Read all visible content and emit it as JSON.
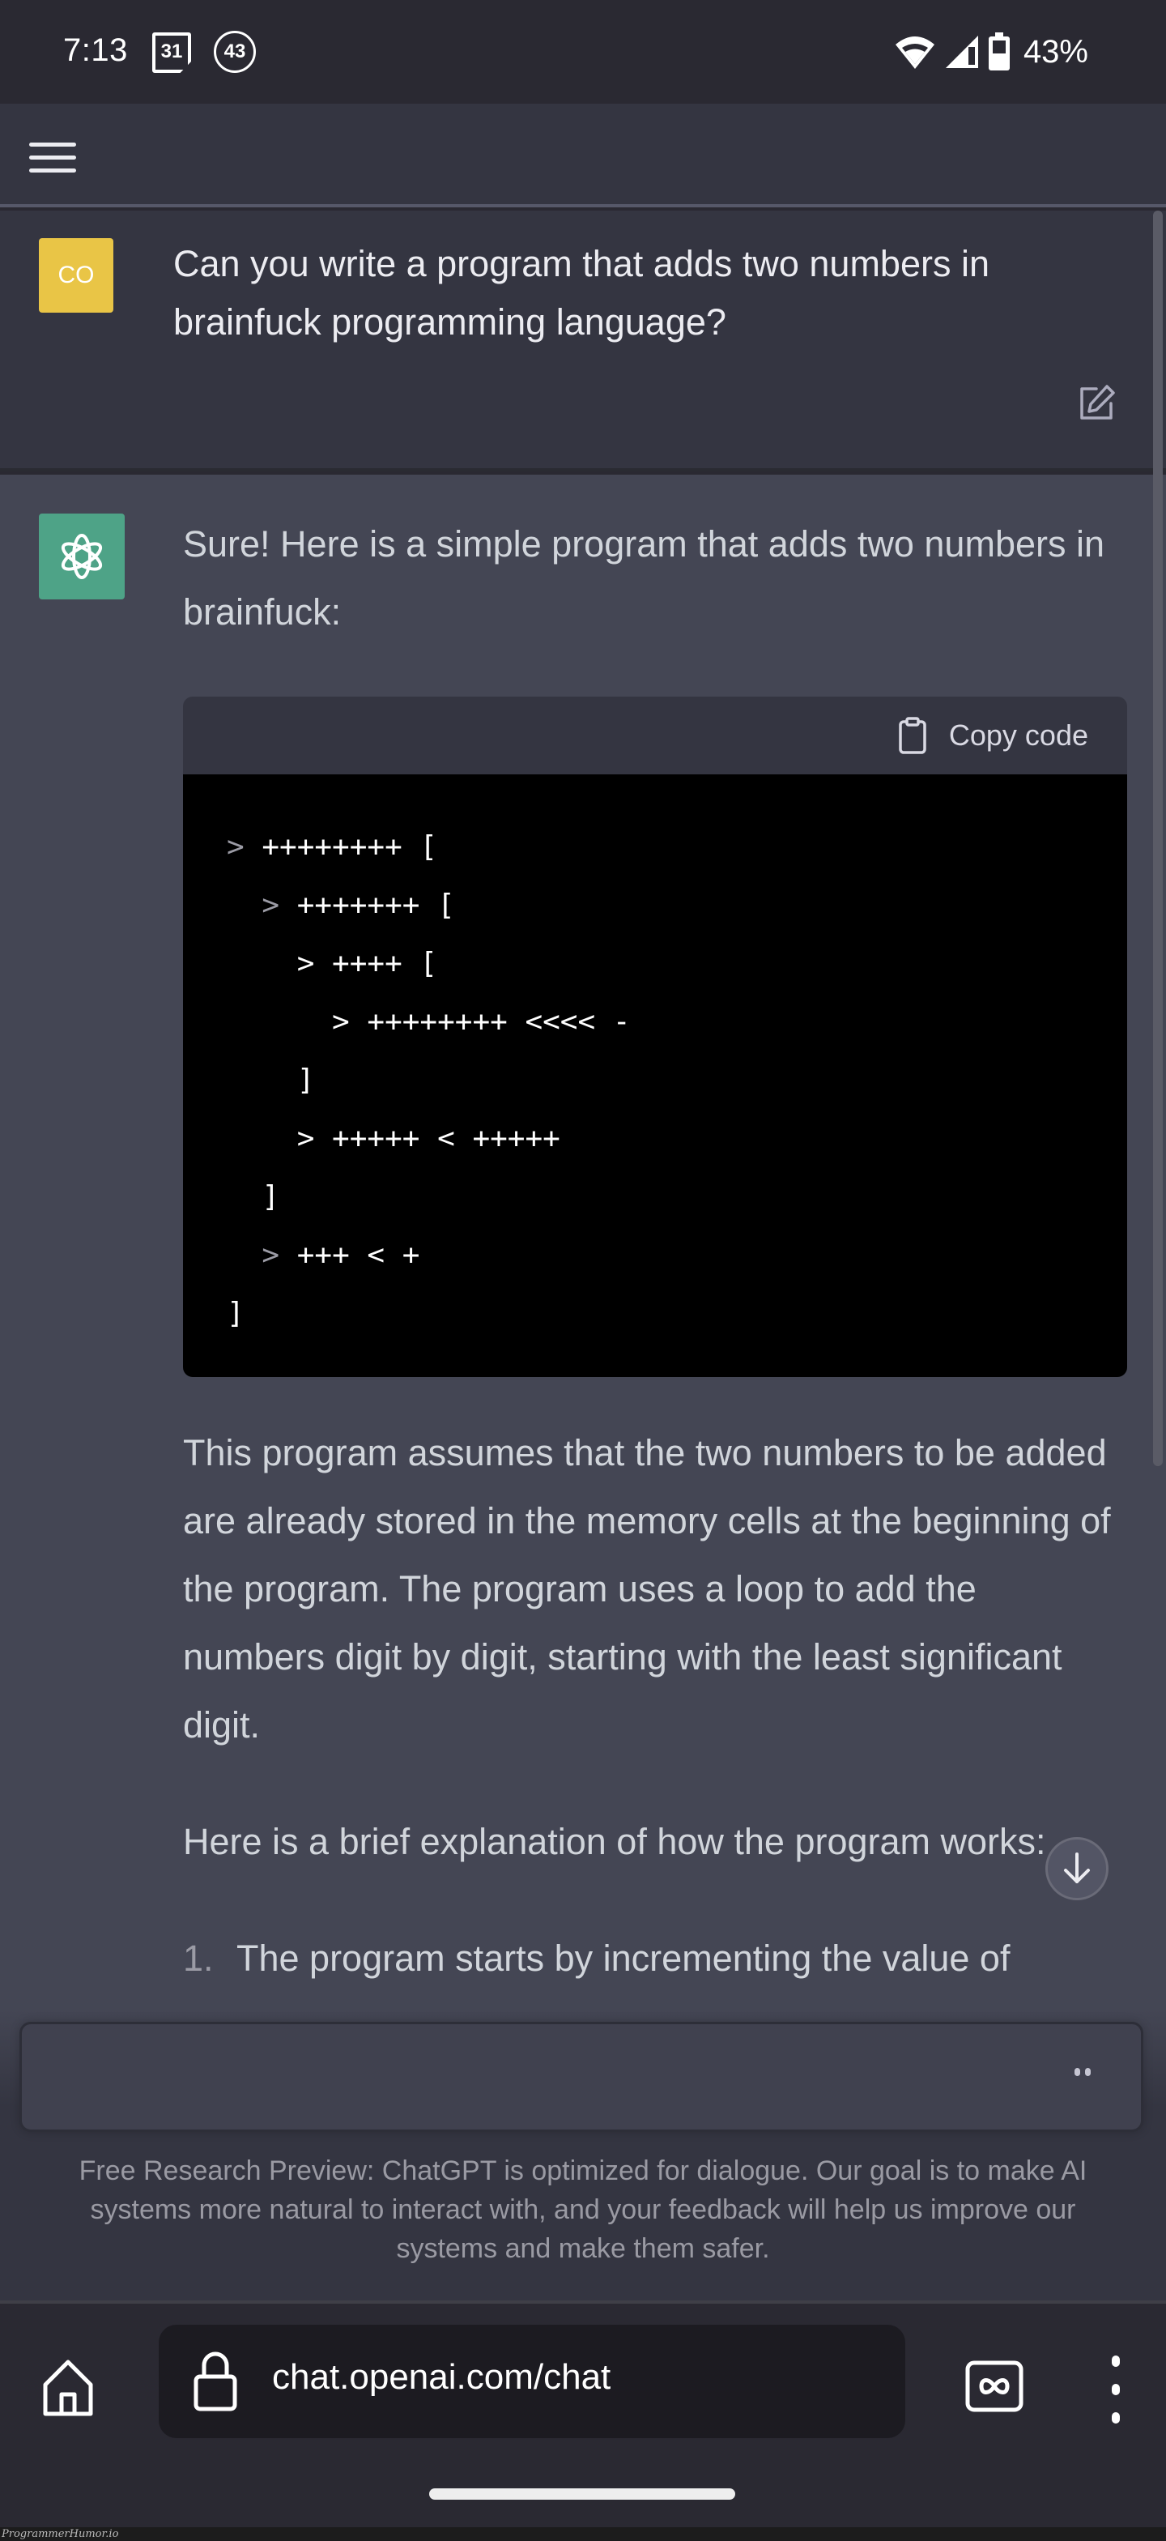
{
  "status_bar": {
    "time": "7:13",
    "calendar_badge": "31",
    "notification_badge": "43",
    "battery_percent": "43%",
    "icons": [
      "wifi-icon",
      "cell-signal-icon",
      "battery-icon"
    ]
  },
  "header": {
    "menu_icon": "hamburger-menu-icon"
  },
  "conversation": {
    "user_message": {
      "avatar_initials": "CO",
      "avatar_color": "#e9c546",
      "text": "Can you write a program that adds two numbers in brainfuck programming language?",
      "edit_icon": "edit-icon"
    },
    "assistant_message": {
      "avatar_icon": "openai-logo-icon",
      "avatar_color": "#4ea387",
      "intro": "Sure! Here is a simple program that adds two numbers in brainfuck:",
      "code_block": {
        "copy_label": "Copy code",
        "copy_icon": "clipboard-icon",
        "lines": [
          {
            "indent": "",
            "text": "> ++++++++ ["
          },
          {
            "indent": "  ",
            "text": "> +++++++ ["
          },
          {
            "indent": "    ",
            "text": "> ++++ ["
          },
          {
            "indent": "      ",
            "text": "> ++++++++ <<<< -"
          },
          {
            "indent": "    ",
            "text": "]"
          },
          {
            "indent": "    ",
            "text": "> +++++ < +++++"
          },
          {
            "indent": "  ",
            "text": "]"
          },
          {
            "indent": "  ",
            "text": "> +++ < +"
          },
          {
            "indent": "",
            "text": "]"
          }
        ]
      },
      "paragraph_1": "This program assumes that the two numbers to be added are already stored in the memory cells at the beginning of the program. The program uses a loop to add the numbers digit by digit, starting with the least significant digit.",
      "paragraph_2": "Here is a brief explanation of how the program works:",
      "list": [
        {
          "number": "1.",
          "text": "The program starts by incrementing the value of"
        }
      ]
    }
  },
  "composer": {
    "input_value": "",
    "placeholder": "",
    "status_icon": "typing-dots-icon"
  },
  "footer_note": "Free Research Preview: ChatGPT is optimized for dialogue. Our goal is to make AI systems more natural to interact with, and your feedback will help us improve our systems and make them safer.",
  "browser": {
    "url": "chat.openai.com/chat",
    "home_icon": "home-icon",
    "lock_icon": "lock-icon",
    "tabs_icon": "incognito-tabs-icon",
    "menu_icon": "more-vertical-icon"
  },
  "watermark": "ProgrammerHumor.io",
  "colors": {
    "status_bg": "#2a2932",
    "user_bg": "#343541",
    "assistant_bg": "#444654",
    "code_bg": "#000000",
    "input_bg": "#40414f"
  }
}
